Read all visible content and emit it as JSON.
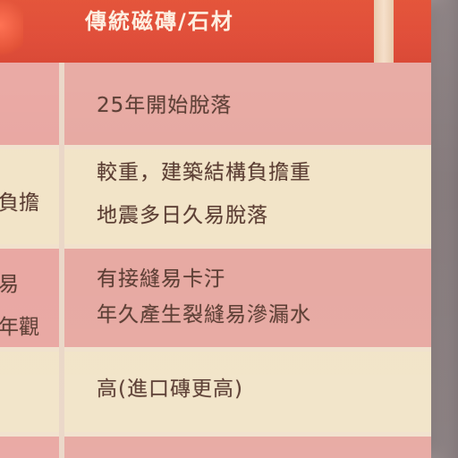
{
  "header": {
    "title": "傳統磁磚/石材"
  },
  "rows": [
    {
      "left_fragment": "",
      "lines": [
        "25年開始脫落"
      ]
    },
    {
      "left_fragment": "負擔",
      "lines": [
        "較重，建築結構負擔重",
        "地震多日久易脫落"
      ]
    },
    {
      "left_fragment_1": "易",
      "left_fragment_2": "年觀",
      "lines": [
        "有接縫易卡汙",
        "年久產生裂縫易滲漏水"
      ]
    },
    {
      "left_fragment": "",
      "lines": [
        "高(進口磚更高)"
      ]
    }
  ],
  "colors": {
    "header": "#e24b2f",
    "pink_row": "#e7a9a2",
    "cream_row": "#f2e4c8",
    "text": "#5a3c32",
    "header_text": "#fff6e8"
  }
}
